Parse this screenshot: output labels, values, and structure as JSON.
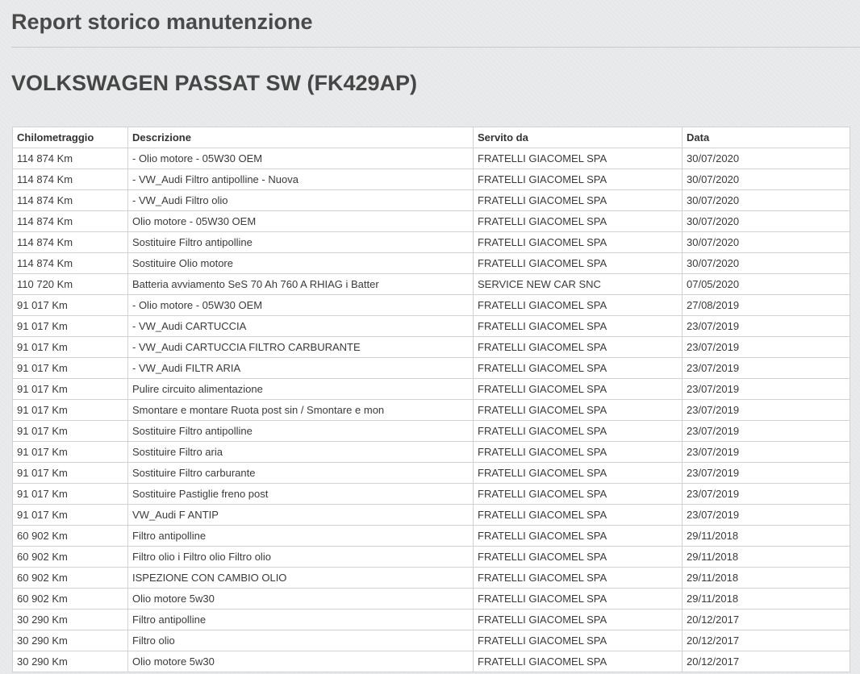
{
  "page": {
    "title": "Report storico manutenzione",
    "vehicle": "VOLKSWAGEN PASSAT SW (FK429AP)"
  },
  "table": {
    "headers": [
      "Chilometraggio",
      "Descrizione",
      "Servito da",
      "Data"
    ],
    "rows": [
      [
        "114 874 Km",
        "- Olio motore - 05W30 OEM",
        "FRATELLI GIACOMEL SPA",
        "30/07/2020"
      ],
      [
        "114 874 Km",
        "- VW_Audi Filtro antipolline - Nuova",
        "FRATELLI GIACOMEL SPA",
        "30/07/2020"
      ],
      [
        "114 874 Km",
        "- VW_Audi Filtro olio",
        "FRATELLI GIACOMEL SPA",
        "30/07/2020"
      ],
      [
        "114 874 Km",
        "Olio motore - 05W30 OEM",
        "FRATELLI GIACOMEL SPA",
        "30/07/2020"
      ],
      [
        "114 874 Km",
        "Sostituire Filtro antipolline",
        "FRATELLI GIACOMEL SPA",
        "30/07/2020"
      ],
      [
        "114 874 Km",
        "Sostituire Olio motore",
        "FRATELLI GIACOMEL SPA",
        "30/07/2020"
      ],
      [
        "110 720 Km",
        "Batteria avviamento SeS 70 Ah 760 A RHIAG i Batter",
        "SERVICE NEW CAR SNC",
        "07/05/2020"
      ],
      [
        "91 017 Km",
        "- Olio motore - 05W30 OEM",
        "FRATELLI GIACOMEL SPA",
        "27/08/2019"
      ],
      [
        "91 017 Km",
        "- VW_Audi CARTUCCIA",
        "FRATELLI GIACOMEL SPA",
        "23/07/2019"
      ],
      [
        "91 017 Km",
        "- VW_Audi CARTUCCIA FILTRO CARBURANTE",
        "FRATELLI GIACOMEL SPA",
        "23/07/2019"
      ],
      [
        "91 017 Km",
        "- VW_Audi FILTR ARIA",
        "FRATELLI GIACOMEL SPA",
        "23/07/2019"
      ],
      [
        "91 017 Km",
        "Pulire circuito alimentazione",
        "FRATELLI GIACOMEL SPA",
        "23/07/2019"
      ],
      [
        "91 017 Km",
        "Smontare e montare Ruota post sin / Smontare e mon",
        "FRATELLI GIACOMEL SPA",
        "23/07/2019"
      ],
      [
        "91 017 Km",
        "Sostituire Filtro antipolline",
        "FRATELLI GIACOMEL SPA",
        "23/07/2019"
      ],
      [
        "91 017 Km",
        "Sostituire Filtro aria",
        "FRATELLI GIACOMEL SPA",
        "23/07/2019"
      ],
      [
        "91 017 Km",
        "Sostituire Filtro carburante",
        "FRATELLI GIACOMEL SPA",
        "23/07/2019"
      ],
      [
        "91 017 Km",
        "Sostituire Pastiglie freno post",
        "FRATELLI GIACOMEL SPA",
        "23/07/2019"
      ],
      [
        "91 017 Km",
        "VW_Audi F ANTIP",
        "FRATELLI GIACOMEL SPA",
        "23/07/2019"
      ],
      [
        "60 902 Km",
        "Filtro antipolline",
        "FRATELLI GIACOMEL SPA",
        "29/11/2018"
      ],
      [
        "60 902 Km",
        "Filtro olio i Filtro olio Filtro olio",
        "FRATELLI GIACOMEL SPA",
        "29/11/2018"
      ],
      [
        "60 902 Km",
        "ISPEZIONE CON CAMBIO OLIO",
        "FRATELLI GIACOMEL SPA",
        "29/11/2018"
      ],
      [
        "60 902 Km",
        "Olio motore 5w30",
        "FRATELLI GIACOMEL SPA",
        "29/11/2018"
      ],
      [
        "30 290 Km",
        "Filtro antipolline",
        "FRATELLI GIACOMEL SPA",
        "20/12/2017"
      ],
      [
        "30 290 Km",
        "Filtro olio",
        "FRATELLI GIACOMEL SPA",
        "20/12/2017"
      ],
      [
        "30 290 Km",
        "Olio motore 5w30",
        "FRATELLI GIACOMEL SPA",
        "20/12/2017"
      ]
    ]
  }
}
